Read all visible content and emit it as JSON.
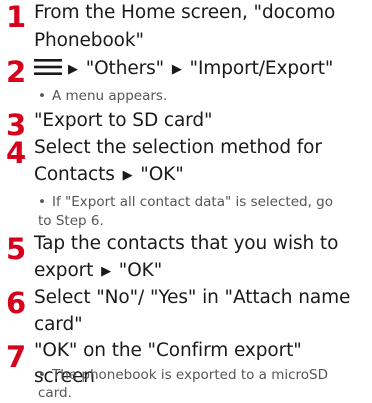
{
  "steps": [
    {
      "number": "1",
      "lines": [
        "From the Home screen, \"docomo",
        "Phonebook\""
      ]
    },
    {
      "number": "2",
      "icon": "menu-icon",
      "arrow": "▶",
      "part1": "\"Others\"",
      "part2": "\"Import/Export\"",
      "note": "A menu appears."
    },
    {
      "number": "3",
      "lines": [
        "\"Export to SD card\""
      ]
    },
    {
      "number": "4",
      "line1": "Select the selection method for",
      "line2_part1": "Contacts",
      "arrow": "▶",
      "line2_part2": "\"OK\"",
      "note_line1": "If \"Export all contact data\" is selected, go",
      "note_line2": "to Step 6."
    },
    {
      "number": "5",
      "line1": "Tap the contacts that you wish to",
      "line2_part1": "export",
      "arrow": "▶",
      "line2_part2": "\"OK\""
    },
    {
      "number": "6",
      "lines": [
        "Select \"No\"/ \"Yes\" in \"Attach name",
        "card\""
      ]
    },
    {
      "number": "7",
      "line1": "\"OK\" on the \"Confirm export\" screen",
      "note_line1": "The phonebook is exported to a microSD",
      "note_line2": "card."
    }
  ],
  "bullet": "•",
  "colors": {
    "step_number": "#d6001c",
    "text": "#1a1a1a",
    "note": "#555555"
  }
}
